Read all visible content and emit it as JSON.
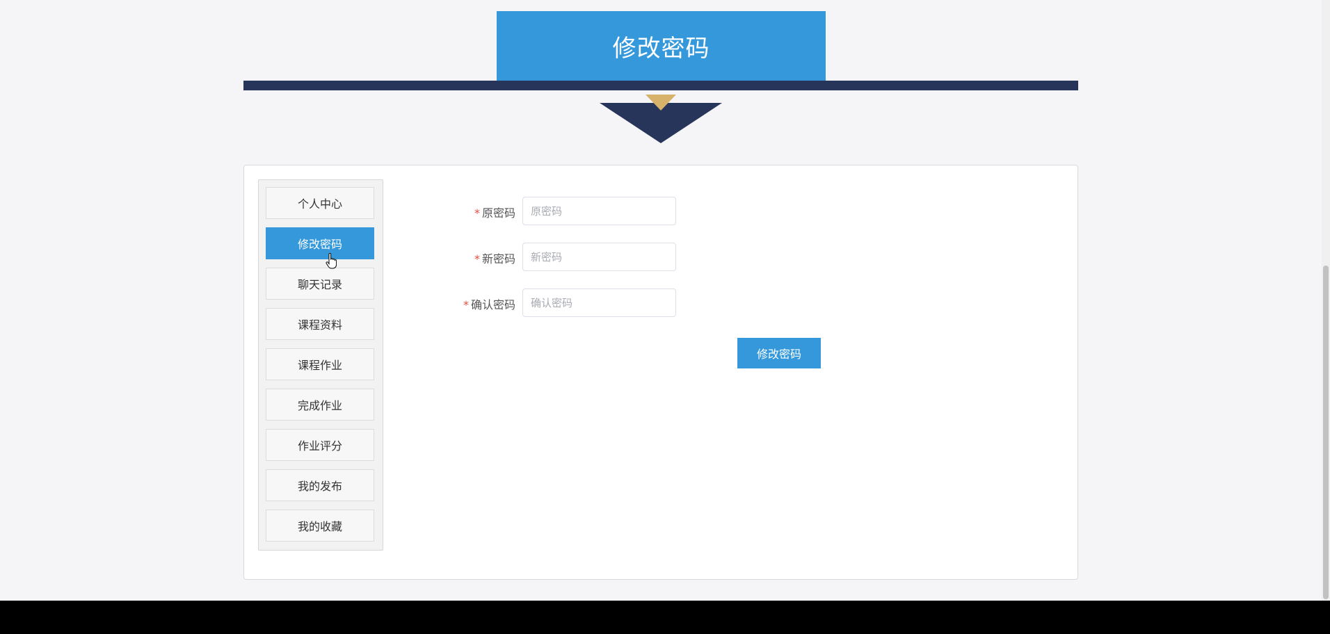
{
  "title": "修改密码",
  "sidebar": {
    "items": [
      {
        "label": "个人中心",
        "active": false
      },
      {
        "label": "修改密码",
        "active": true
      },
      {
        "label": "聊天记录",
        "active": false
      },
      {
        "label": "课程资料",
        "active": false
      },
      {
        "label": "课程作业",
        "active": false
      },
      {
        "label": "完成作业",
        "active": false
      },
      {
        "label": "作业评分",
        "active": false
      },
      {
        "label": "我的发布",
        "active": false
      },
      {
        "label": "我的收藏",
        "active": false
      }
    ]
  },
  "form": {
    "fields": [
      {
        "label": "原密码",
        "placeholder": "原密码",
        "value": "",
        "required": true
      },
      {
        "label": "新密码",
        "placeholder": "新密码",
        "value": "",
        "required": true
      },
      {
        "label": "确认密码",
        "placeholder": "确认密码",
        "value": "",
        "required": true
      }
    ],
    "required_mark": "*",
    "submit_label": "修改密码"
  },
  "colors": {
    "accent": "#3498db",
    "navy": "#27355a",
    "gold": "#d6b26a",
    "required": "#e74c3c"
  }
}
